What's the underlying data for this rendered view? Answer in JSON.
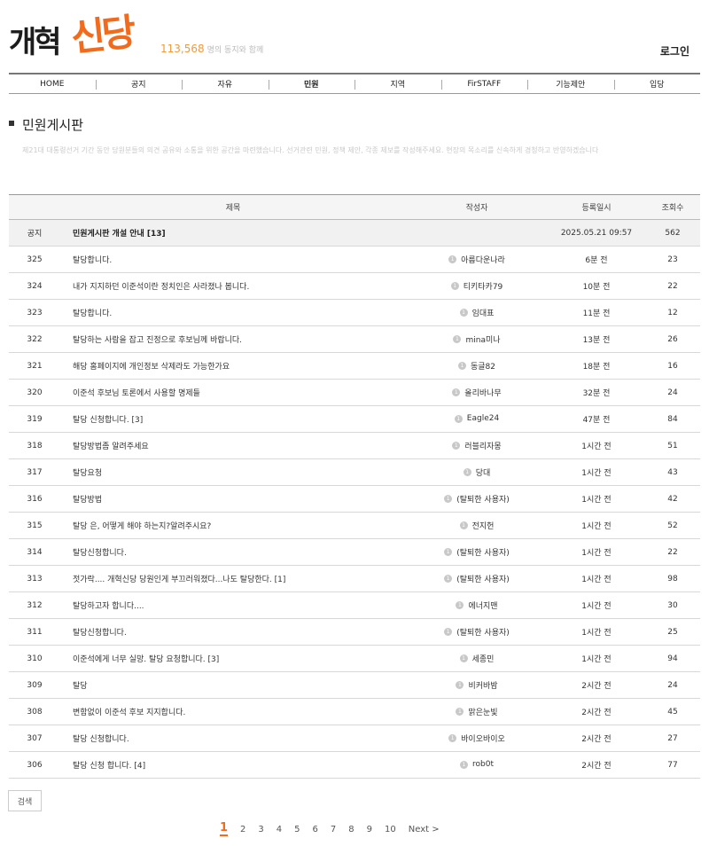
{
  "header": {
    "logo_part1": "개혁",
    "logo_part2": "신당",
    "member_count": "113,568",
    "member_text": "명의 동지와 함께",
    "login_label": "로그인"
  },
  "nav": [
    "HOME",
    "공지",
    "자유",
    "민원",
    "지역",
    "FirSTAFF",
    "기능제안",
    "입당"
  ],
  "nav_active": "민원",
  "board": {
    "title": "민원게시판",
    "description": "제21대 대통령선거 기간 동안 당원분들의 의견 공유와 소통을 위한 공간을 마련했습니다. 선거관련 민원, 정책 제안, 각종 제보를 작성해주세요. 현장의 목소리를 신속하게 경청하고 반영하겠습니다"
  },
  "table": {
    "headers": {
      "num": "",
      "title": "제목",
      "author": "작성자",
      "date": "등록일시",
      "views": "조회수"
    },
    "notice": {
      "num": "공지",
      "title": "민원게시판 개설 안내 [13]",
      "author": "",
      "date": "2025.05.21 09:57",
      "views": "562"
    },
    "rows": [
      {
        "num": "325",
        "title": "탈당합니다.",
        "level": "1",
        "author": "아름다운나라",
        "date": "6분 전",
        "views": "23"
      },
      {
        "num": "324",
        "title": "내가 지지하던 이준석이란 정치인은 사라졌나 봅니다.",
        "level": "1",
        "author": "티키타카79",
        "date": "10분 전",
        "views": "22"
      },
      {
        "num": "323",
        "title": "탈당합니다.",
        "level": "1",
        "author": "임대표",
        "date": "11분 전",
        "views": "12"
      },
      {
        "num": "322",
        "title": "탈당하는 사람을 잡고 진정으로 후보님께 바랍니다.",
        "level": "1",
        "author": "mina미나",
        "date": "13분 전",
        "views": "26"
      },
      {
        "num": "321",
        "title": "해당 홈페이지에 개인정보 삭제라도 가능한가요",
        "level": "1",
        "author": "동글82",
        "date": "18분 전",
        "views": "16"
      },
      {
        "num": "320",
        "title": "이준석 후보님 토론에서 사용할 명제들",
        "level": "1",
        "author": "올리바나무",
        "date": "32분 전",
        "views": "24"
      },
      {
        "num": "319",
        "title": "탈당 신청합니다. [3]",
        "level": "1",
        "author": "Eagle24",
        "date": "47분 전",
        "views": "84"
      },
      {
        "num": "318",
        "title": "탈당방법좀 알려주세요",
        "level": "1",
        "author": "러블리자몽",
        "date": "1시간 전",
        "views": "51"
      },
      {
        "num": "317",
        "title": "탈당요청",
        "level": "1",
        "author": "당대",
        "date": "1시간 전",
        "views": "43"
      },
      {
        "num": "316",
        "title": "탈당방법",
        "level": "1",
        "author": "(탈퇴한 사용자)",
        "date": "1시간 전",
        "views": "42"
      },
      {
        "num": "315",
        "title": "탈당 은, 어떻게 해야 하는지?알려주시요?",
        "level": "1",
        "author": "전지헌",
        "date": "1시간 전",
        "views": "52"
      },
      {
        "num": "314",
        "title": "탈당신청합니다.",
        "level": "1",
        "author": "(탈퇴한 사용자)",
        "date": "1시간 전",
        "views": "22"
      },
      {
        "num": "313",
        "title": "젓가락.... 개혁신당 당원인게 부끄러워졌다...나도 탈당한다. [1]",
        "level": "1",
        "author": "(탈퇴한 사용자)",
        "date": "1시간 전",
        "views": "98"
      },
      {
        "num": "312",
        "title": "탈당하고자 합니다....",
        "level": "1",
        "author": "에너지맨",
        "date": "1시간 전",
        "views": "30"
      },
      {
        "num": "311",
        "title": "탈당신청합니다.",
        "level": "1",
        "author": "(탈퇴한 사용자)",
        "date": "1시간 전",
        "views": "25"
      },
      {
        "num": "310",
        "title": "이준석에게 너무 실망. 탈당 요청합니다. [3]",
        "level": "1",
        "author": "세종민",
        "date": "1시간 전",
        "views": "94"
      },
      {
        "num": "309",
        "title": "탈당",
        "level": "1",
        "author": "비커바밤",
        "date": "2시간 전",
        "views": "24"
      },
      {
        "num": "308",
        "title": "변함없이 이준석 후보 지지합니다.",
        "level": "1",
        "author": "맑은눈빛",
        "date": "2시간 전",
        "views": "45"
      },
      {
        "num": "307",
        "title": "탈당 신청합니다.",
        "level": "1",
        "author": "바이오바이오",
        "date": "2시간 전",
        "views": "27"
      },
      {
        "num": "306",
        "title": "탈당 신청 합니다. [4]",
        "level": "1",
        "author": "rob0t",
        "date": "2시간 전",
        "views": "77"
      }
    ]
  },
  "search_label": "검색",
  "pagination": {
    "pages": [
      "1",
      "2",
      "3",
      "4",
      "5",
      "6",
      "7",
      "8",
      "9",
      "10"
    ],
    "current": "1",
    "next_label": "Next >"
  },
  "colors": {
    "accent": "#f26b1d",
    "member_count": "#f29a3a",
    "header_bg": "#f5f5f5"
  }
}
